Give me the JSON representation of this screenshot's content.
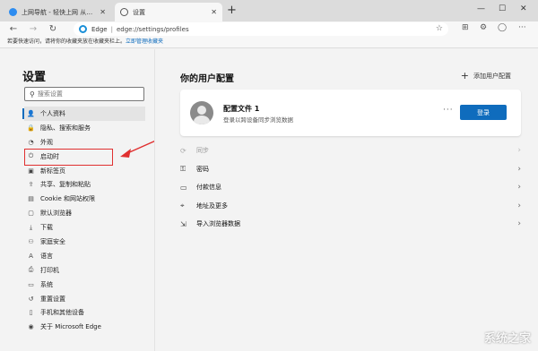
{
  "tabs": [
    {
      "title": "上网导航 - 轻快上网 从这里开始",
      "active": false
    },
    {
      "title": "设置",
      "active": true
    }
  ],
  "address": {
    "site": "Edge",
    "url": "edge://settings/profiles"
  },
  "favbar": {
    "text": "若要快速访问，请将你的收藏夹放在收藏夹栏上。",
    "link": "立即管理收藏夹"
  },
  "sidebar": {
    "title": "设置",
    "search_placeholder": "搜索设置",
    "items": [
      {
        "icon": "person-icon",
        "glyph": "👤",
        "label": "个人资料",
        "selected": true
      },
      {
        "icon": "lock-icon",
        "glyph": "🔒",
        "label": "隐私、搜索和服务"
      },
      {
        "icon": "palette-icon",
        "glyph": "◔",
        "label": "外观"
      },
      {
        "icon": "power-icon",
        "glyph": "⏻",
        "label": "启动时"
      },
      {
        "icon": "newtab-icon",
        "glyph": "▣",
        "label": "新标签页"
      },
      {
        "icon": "share-icon",
        "glyph": "⇪",
        "label": "共享、复制和粘贴"
      },
      {
        "icon": "cookie-icon",
        "glyph": "▤",
        "label": "Cookie 和网站权限"
      },
      {
        "icon": "browser-icon",
        "glyph": "▢",
        "label": "默认浏览器"
      },
      {
        "icon": "download-icon",
        "glyph": "⤓",
        "label": "下载"
      },
      {
        "icon": "family-icon",
        "glyph": "⚇",
        "label": "家庭安全"
      },
      {
        "icon": "language-icon",
        "glyph": "A",
        "label": "语言"
      },
      {
        "icon": "printer-icon",
        "glyph": "⎙",
        "label": "打印机"
      },
      {
        "icon": "system-icon",
        "glyph": "▭",
        "label": "系统"
      },
      {
        "icon": "reset-icon",
        "glyph": "↺",
        "label": "重置设置"
      },
      {
        "icon": "phone-icon",
        "glyph": "▯",
        "label": "手机和其他设备"
      },
      {
        "icon": "edge-icon",
        "glyph": "◉",
        "label": "关于 Microsoft Edge"
      }
    ]
  },
  "main": {
    "heading": "你的用户配置",
    "add_profile": "添加用户配置",
    "profile": {
      "name": "配置文件 1",
      "desc": "登录以跨设备同步浏览数据",
      "more": "···",
      "login": "登录"
    },
    "rows": [
      {
        "icon": "sync-icon",
        "glyph": "⟳",
        "label": "同步",
        "dim": true
      },
      {
        "icon": "key-icon",
        "glyph": "⚿",
        "label": "密码"
      },
      {
        "icon": "card-icon",
        "glyph": "▭",
        "label": "付款信息"
      },
      {
        "icon": "location-icon",
        "glyph": "⌖",
        "label": "地址及更多"
      },
      {
        "icon": "import-icon",
        "glyph": "⇲",
        "label": "导入浏览器数据"
      }
    ]
  },
  "watermark": "系统之家",
  "colors": {
    "accent": "#0f6cbd",
    "highlight": "#e03030"
  }
}
